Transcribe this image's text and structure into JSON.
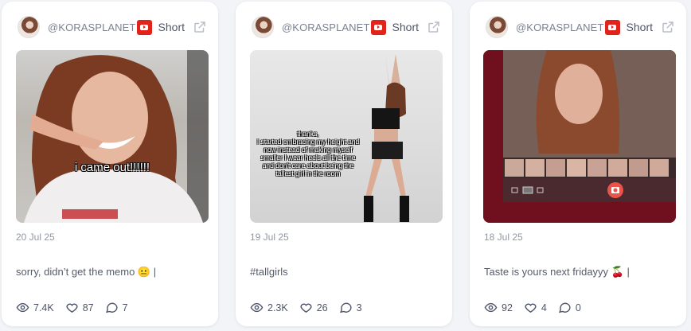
{
  "cards": [
    {
      "handle": "@KORASPLANET",
      "type": "Short",
      "overlay": "i came out!!!!!!",
      "date": "20 Jul 25",
      "caption": "sorry, didn’t get the memo 😐 |",
      "views": "7.4K",
      "likes": "87",
      "comments": "7"
    },
    {
      "handle": "@KORASPLANET",
      "type": "Short",
      "overlay": "thanks,\nI started embracing my height and now instead of making myself smaller I wear heels all the time and don't care about being the tallest girl in the room",
      "date": "19 Jul 25",
      "caption": "#tallgirls",
      "views": "2.3K",
      "likes": "26",
      "comments": "3"
    },
    {
      "handle": "@KORASPLANET",
      "type": "Short",
      "date": "18 Jul 25",
      "caption": "Taste is yours next fridayyy 🍒 |",
      "views": "92",
      "likes": "4",
      "comments": "0"
    }
  ],
  "colors": {
    "brand_red": "#e0241c",
    "card_bg": "#ffffff",
    "page_bg": "#f3f4f7",
    "muted": "#9097a5"
  },
  "icons": {
    "platform": "youtube-icon",
    "open": "external-link-icon",
    "views": "eye-icon",
    "likes": "heart-icon",
    "comments": "comment-icon"
  }
}
